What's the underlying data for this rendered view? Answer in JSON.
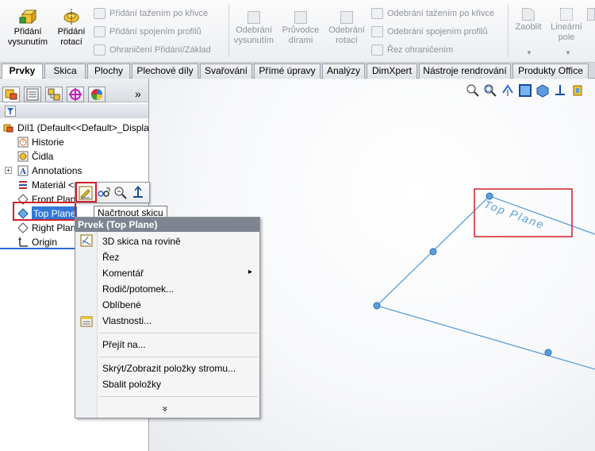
{
  "ribbon": {
    "extrude_boss": "Přidání vysunutím",
    "revolve_boss": "Přidání rotací",
    "swept_boss": "Přidání tažením po křivce",
    "lofted_boss": "Přidání spojením profilů",
    "boundary_boss": "Ohraničení Přidání/Základ",
    "extruded_cut": "Odebrání vysunutím",
    "hole_wizard": "Průvodce dírami",
    "revolved_cut": "Odebrání rotací",
    "swept_cut": "Odebrání tažením po křivce",
    "lofted_cut": "Odebrání spojením profilů",
    "boundary_cut": "Řez ohraničením",
    "fillet": "Zaoblit",
    "linear_pattern": "Lineární pole"
  },
  "tabs": [
    "Prvky",
    "Skica",
    "Plochy",
    "Plechové díly",
    "Svařování",
    "Přímé úpravy",
    "Analýzy",
    "DimXpert",
    "Nástroje rendrování",
    "Produkty Office"
  ],
  "tree": {
    "root": "Díl1  (Default<<Default>_Displa",
    "items": [
      "Historie",
      "Čidla",
      "Annotations",
      "Materiál <neu",
      "Front Plane",
      "Top Plane",
      "Right Plane",
      "Origin"
    ],
    "collapse_glyph": "»"
  },
  "tooltip": "Načrtnout skicu",
  "menu": {
    "header": "Prvek (Top Plane)",
    "items": [
      "3D skica na rovině",
      "Řez",
      "Komentář",
      "Rodič/potomek...",
      "Oblíbené",
      "Vlastnosti...",
      "Přejít na...",
      "Skrýt/Zobrazit položky stromu...",
      "Sbalit položky"
    ],
    "submenu_arrow": "▸",
    "expand_glyph": "»"
  },
  "viewport": {
    "plane_label": "Top Plane",
    "plane_color": "#5aa0d8",
    "highlight_color": "#d0202a"
  }
}
